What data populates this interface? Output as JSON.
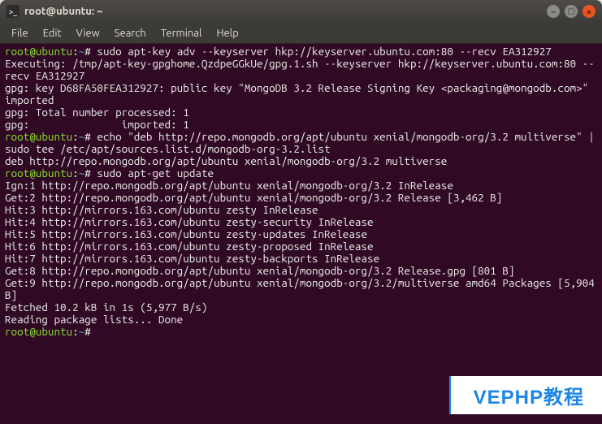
{
  "window": {
    "title": "root@ubuntu: ~",
    "controls": {
      "min": "–",
      "max": "▢",
      "close": "×"
    }
  },
  "menubar": {
    "items": [
      "File",
      "Edit",
      "View",
      "Search",
      "Terminal",
      "Help"
    ]
  },
  "prompt": {
    "user_host": "root@ubuntu",
    "sep": ":",
    "path": "~",
    "suffix": "#"
  },
  "terminal": {
    "blocks": [
      {
        "type": "cmd",
        "text": "sudo apt-key adv --keyserver hkp://keyserver.ubuntu.com:80 --recv EA312927"
      },
      {
        "type": "out",
        "text": "Executing: /tmp/apt-key-gpghome.QzdpeGGkUe/gpg.1.sh --keyserver hkp://keyserver.ubuntu.com:80 --recv EA312927"
      },
      {
        "type": "out",
        "text": "gpg: key D68FA50FEA312927: public key \"MongoDB 3.2 Release Signing Key <packaging@mongodb.com>\" imported"
      },
      {
        "type": "out",
        "text": "gpg: Total number processed: 1"
      },
      {
        "type": "out",
        "text": "gpg:               imported: 1"
      },
      {
        "type": "cmd",
        "text": "echo \"deb http://repo.mongodb.org/apt/ubuntu xenial/mongodb-org/3.2 multiverse\" | sudo tee /etc/apt/sources.list.d/mongodb-org-3.2.list"
      },
      {
        "type": "out",
        "text": "deb http://repo.mongodb.org/apt/ubuntu xenial/mongodb-org/3.2 multiverse"
      },
      {
        "type": "cmd",
        "text": "sudo apt-get update"
      },
      {
        "type": "out",
        "text": "Ign:1 http://repo.mongodb.org/apt/ubuntu xenial/mongodb-org/3.2 InRelease"
      },
      {
        "type": "out",
        "text": "Get:2 http://repo.mongodb.org/apt/ubuntu xenial/mongodb-org/3.2 Release [3,462 B]"
      },
      {
        "type": "out",
        "text": "Hit:3 http://mirrors.163.com/ubuntu zesty InRelease"
      },
      {
        "type": "out",
        "text": "Hit:4 http://mirrors.163.com/ubuntu zesty-security InRelease"
      },
      {
        "type": "out",
        "text": "Hit:5 http://mirrors.163.com/ubuntu zesty-updates InRelease"
      },
      {
        "type": "out",
        "text": "Hit:6 http://mirrors.163.com/ubuntu zesty-proposed InRelease"
      },
      {
        "type": "out",
        "text": "Hit:7 http://mirrors.163.com/ubuntu zesty-backports InRelease"
      },
      {
        "type": "out",
        "text": "Get:8 http://repo.mongodb.org/apt/ubuntu xenial/mongodb-org/3.2 Release.gpg [801 B]"
      },
      {
        "type": "out",
        "text": "Get:9 http://repo.mongodb.org/apt/ubuntu xenial/mongodb-org/3.2/multiverse amd64 Packages [5,904 B]"
      },
      {
        "type": "out",
        "text": "Fetched 10.2 kB in 1s (5,977 B/s)"
      },
      {
        "type": "out",
        "text": "Reading package lists... Done"
      },
      {
        "type": "cmd",
        "text": ""
      }
    ]
  },
  "watermark": {
    "text": "VEPHP教程"
  }
}
